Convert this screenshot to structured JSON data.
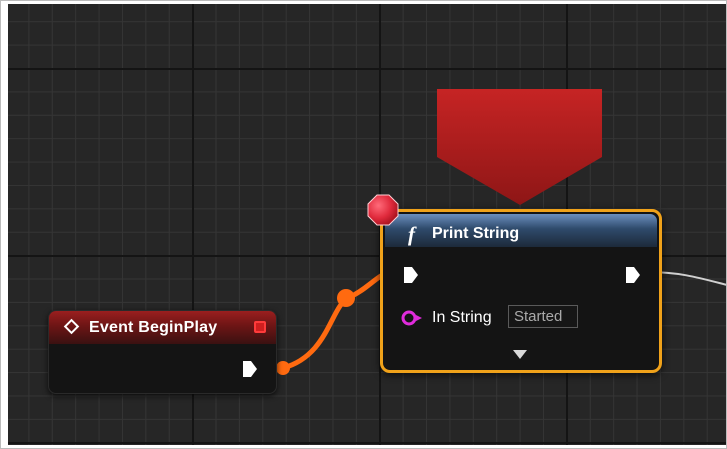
{
  "event_node": {
    "title": "Event BeginPlay",
    "icon": "event-diamond-icon",
    "header_color": "#8a1c1c"
  },
  "print_node": {
    "title": "Print String",
    "icon": "function-f-icon",
    "icon_glyph": "f",
    "header_color": "#3e5f88",
    "selected_outline_color": "#f0a21a",
    "pins": {
      "in_string_label": "In String",
      "in_string_value": "Started"
    }
  },
  "wire": {
    "exec_color": "#ff6a10",
    "out_color": "#d0d0d0"
  },
  "breakpoint": {
    "color": "#e02a3c"
  },
  "debug_arrow": {
    "color": "#b81d1d"
  }
}
